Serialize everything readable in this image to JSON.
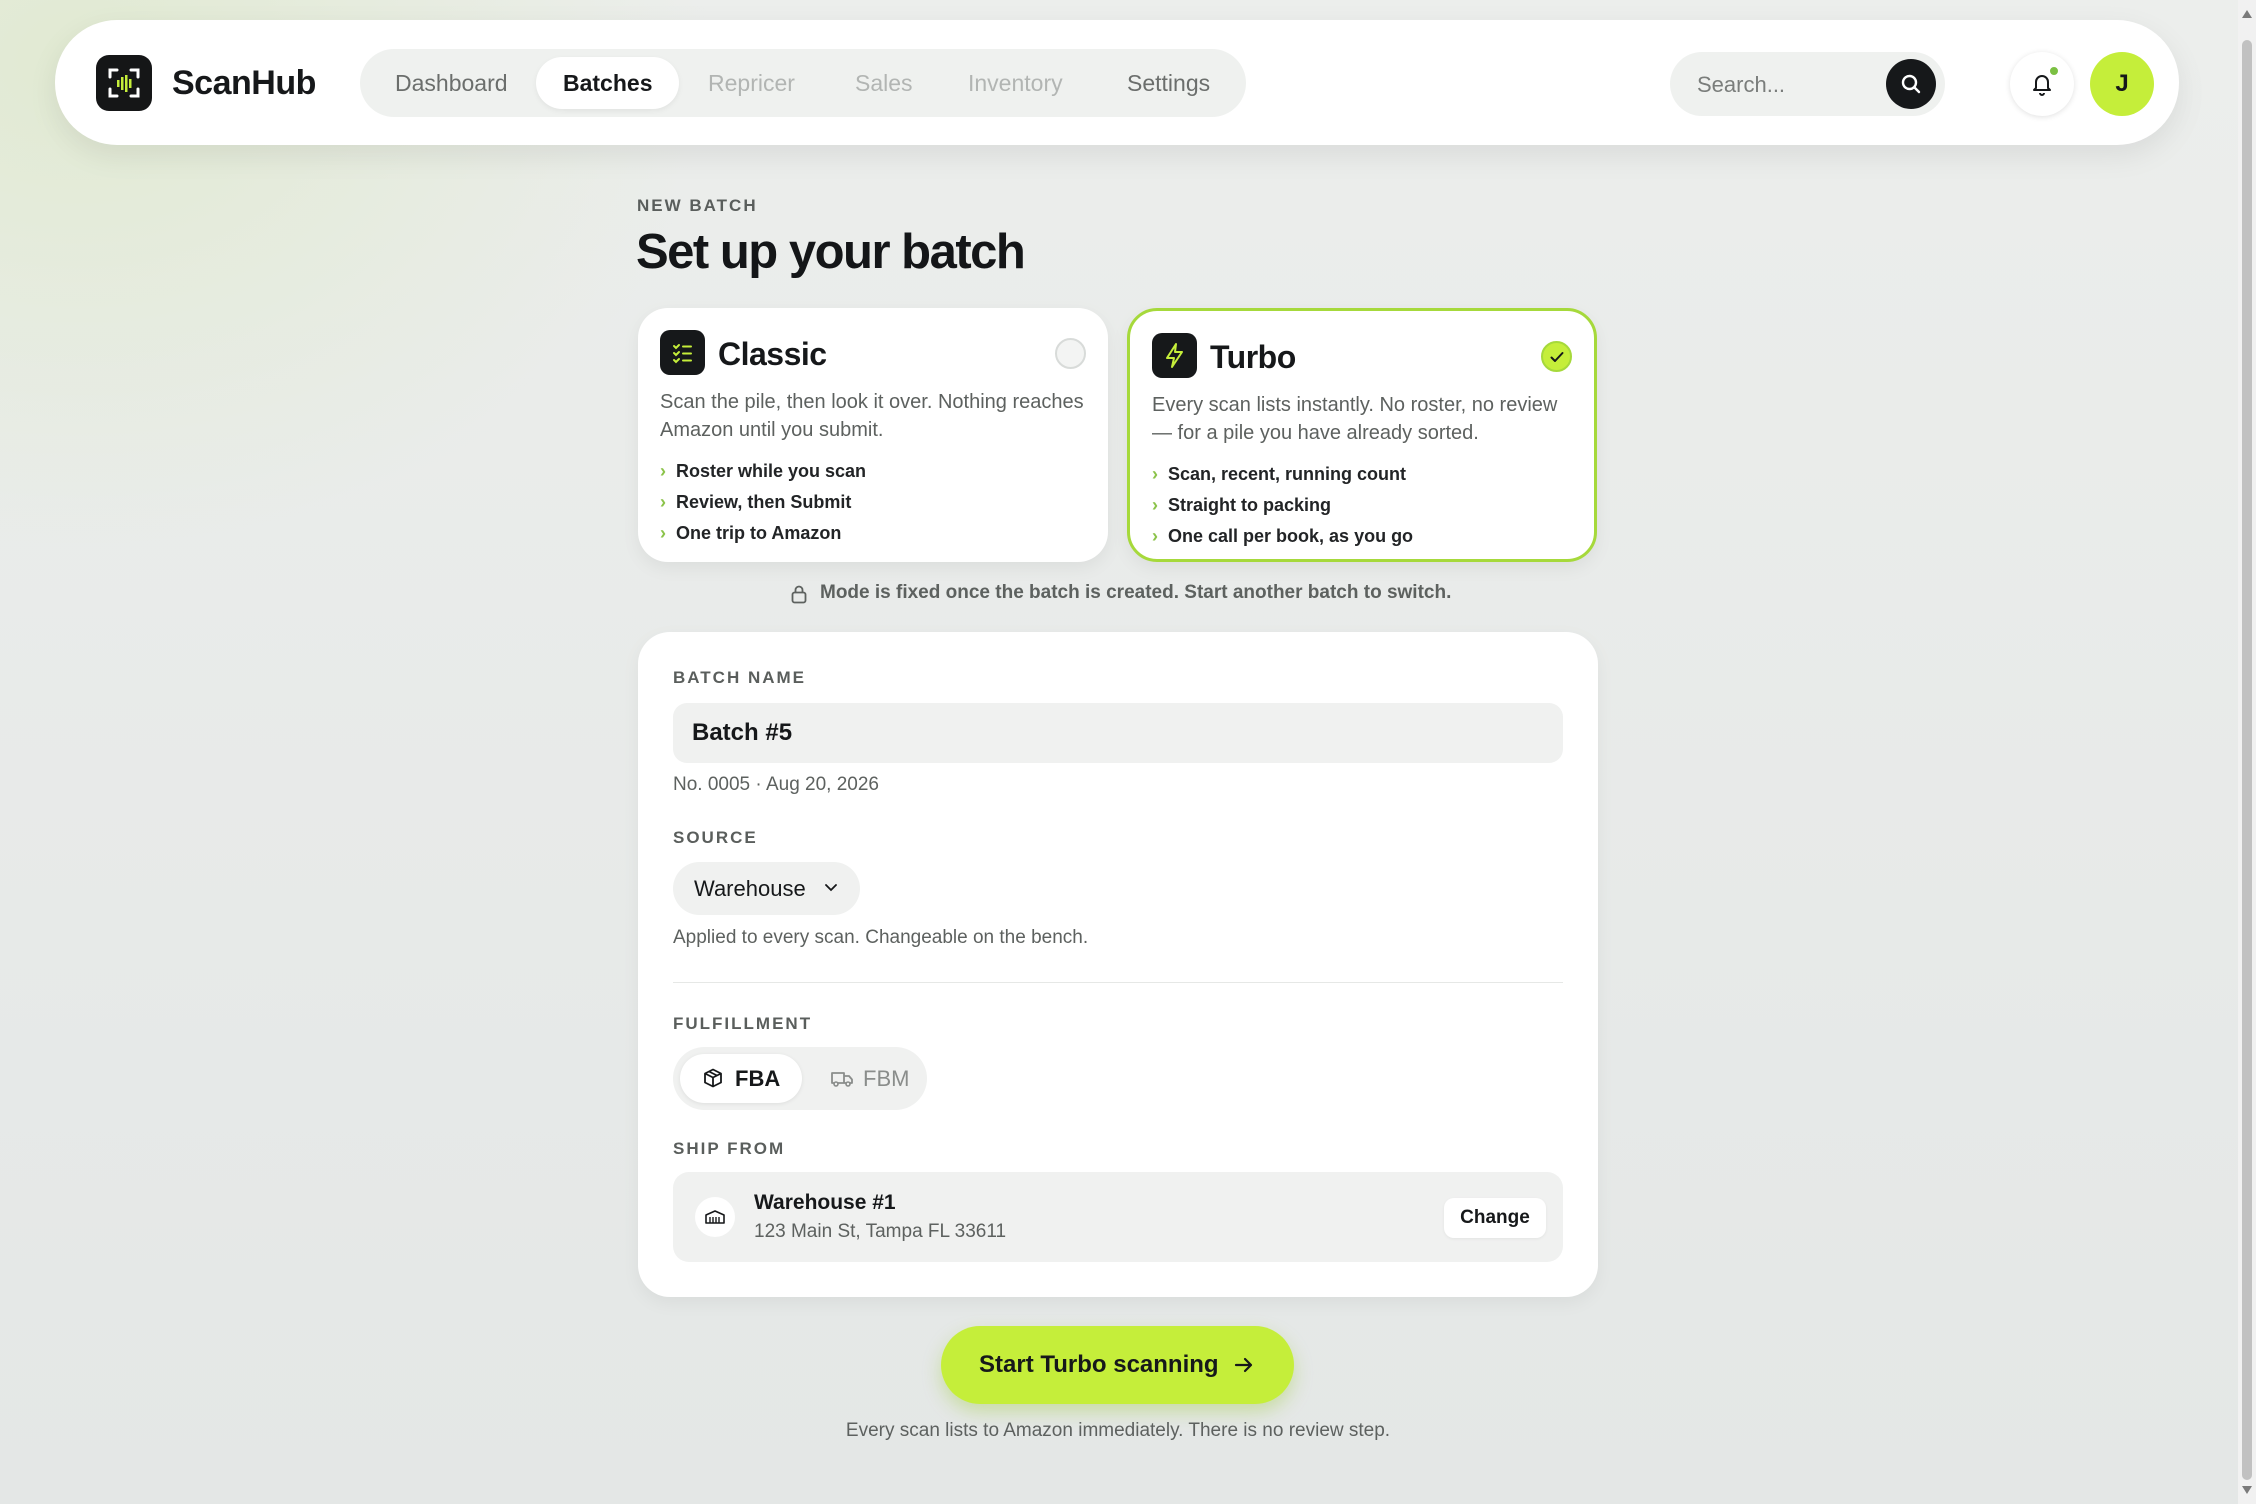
{
  "app": {
    "name": "ScanHub"
  },
  "nav": {
    "items": [
      {
        "label": "Dashboard",
        "state": "normal"
      },
      {
        "label": "Batches",
        "state": "active"
      },
      {
        "label": "Repricer",
        "state": "muted"
      },
      {
        "label": "Sales",
        "state": "muted"
      },
      {
        "label": "Inventory",
        "state": "muted"
      },
      {
        "label": "Settings",
        "state": "normal"
      }
    ]
  },
  "search": {
    "placeholder": "Search..."
  },
  "user": {
    "initial": "J"
  },
  "page": {
    "eyebrow": "NEW BATCH",
    "title": "Set up your batch"
  },
  "modes": {
    "classic": {
      "name": "Classic",
      "description": "Scan the pile, then look it over. Nothing reaches Amazon until you submit.",
      "bullets": [
        "Roster while you scan",
        "Review, then Submit",
        "One trip to Amazon"
      ],
      "selected": false
    },
    "turbo": {
      "name": "Turbo",
      "description": "Every scan lists instantly. No roster, no review — for a pile you have already sorted.",
      "bullets": [
        "Scan, recent, running count",
        "Straight to packing",
        "One call per book, as you go"
      ],
      "selected": true
    },
    "fixed_note": "Mode is fixed once the batch is created. Start another batch to switch."
  },
  "form": {
    "batch_name_label": "BATCH NAME",
    "batch_name_value": "Batch #5",
    "batch_meta": "No. 0005 · Aug 20, 2026",
    "source_label": "SOURCE",
    "source_value": "Warehouse",
    "source_help": "Applied to every scan. Changeable on the bench.",
    "fulfillment_label": "FULFILLMENT",
    "fulfillment_options": [
      "FBA",
      "FBM"
    ],
    "fulfillment_selected": "FBA",
    "ship_from_label": "SHIP FROM",
    "ship_from_name": "Warehouse #1",
    "ship_from_address": "123 Main St, Tampa FL 33611",
    "change_label": "Change"
  },
  "cta": {
    "label": "Start Turbo scanning",
    "note": "Every scan lists to Amazon immediately. There is no review step."
  },
  "colors": {
    "accent": "#c5ee3a",
    "accent_border": "#a6d93b",
    "dark": "#16181a"
  }
}
